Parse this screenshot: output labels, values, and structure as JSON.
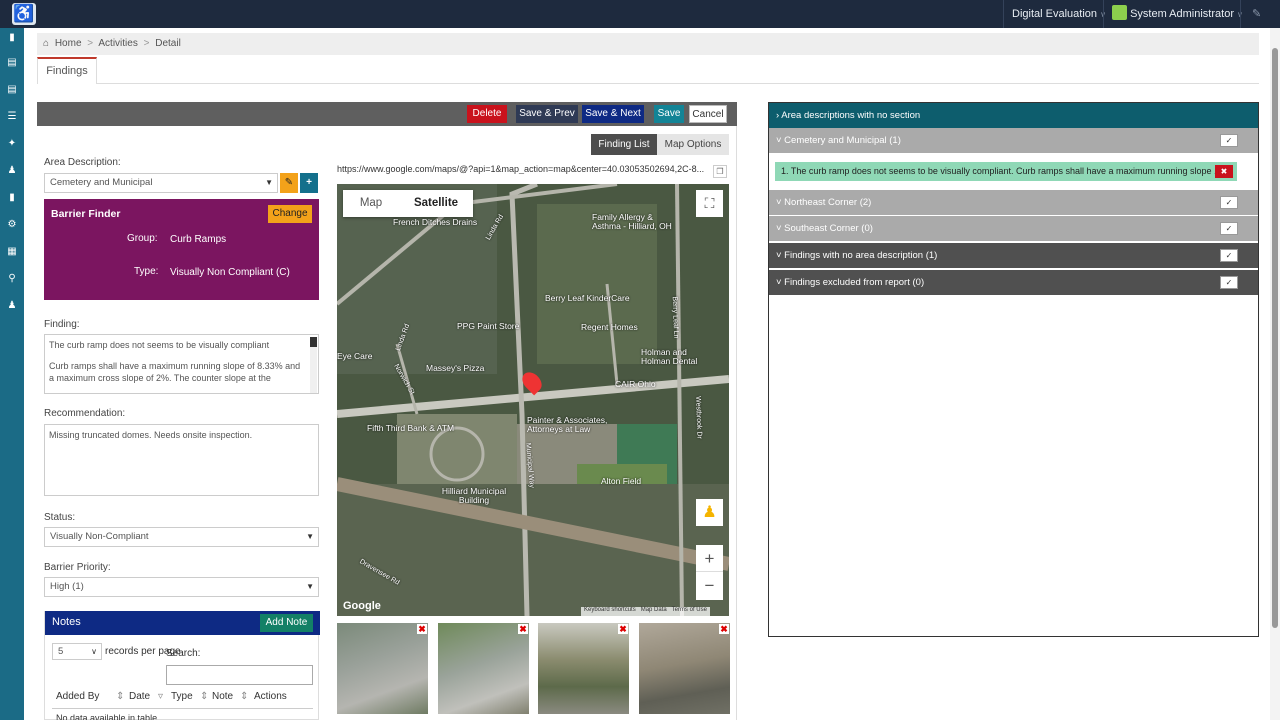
{
  "topbar": {
    "menu_1": "Digital Evaluation",
    "menu_2": "System Administrator"
  },
  "breadcrumb": {
    "home": "Home",
    "activities": "Activities",
    "detail": "Detail",
    "separator": ">"
  },
  "page_tab": "Findings",
  "actions": {
    "delete": "Delete",
    "save_prev": "Save & Prev",
    "save_next": "Save & Next",
    "save": "Save",
    "cancel": "Cancel"
  },
  "view_tabs": {
    "finding_list": "Finding List",
    "map_options": "Map Options"
  },
  "map_url": "https://www.google.com/maps/@?api=1&map_action=map&center=40.03053502694,2C-8...",
  "area_description": {
    "label": "Area Description:",
    "value": "Cemetery and Municipal"
  },
  "barrier_finder": {
    "title": "Barrier Finder",
    "change": "Change",
    "group_label": "Group:",
    "group_value": "Curb Ramps",
    "type_label": "Type:",
    "type_value": "Visually Non Compliant (C)"
  },
  "finding": {
    "label": "Finding:",
    "line1": "The curb ramp does not seems to be visually compliant",
    "line2": "Curb ramps shall have a maximum running slope of 8.33% and a maximum cross slope of 2%. The counter slope at the"
  },
  "recommendation": {
    "label": "Recommendation:",
    "value": "Missing truncated domes. Needs onsite inspection."
  },
  "status": {
    "label": "Status:",
    "value": "Visually Non-Compliant"
  },
  "barrier_priority": {
    "label": "Barrier Priority:",
    "value": "High (1)"
  },
  "notes": {
    "title": "Notes",
    "add_note": "Add Note",
    "per_page_value": "5",
    "per_page_label": "records per page",
    "search_label": "Search:",
    "columns": [
      "Added By",
      "Date",
      "Type",
      "Note",
      "Actions"
    ],
    "empty_text": "No data available in table"
  },
  "map": {
    "type_map": "Map",
    "type_satellite": "Satellite",
    "zoom_in": "+",
    "zoom_out": "−",
    "google": "Google",
    "attribution": "Keyboard shortcuts   Map Data   Terms of Use",
    "places": [
      "French Ditches Drains",
      "Family Allergy & Asthma - Hilliard, OH",
      "Berry Leaf KinderCare",
      "PPG Paint Store",
      "Regent Homes",
      "Holman and Holman Dental",
      "Massey's Pizza",
      "CAIR Ohio",
      "Fifth Third Bank & ATM",
      "Painter & Associates, Attorneys at Law",
      "Alton Field",
      "Hilliard Municipal Building",
      "Eye Care",
      "Linda Rd",
      "Norwich St",
      "Municipal Way",
      "Berry Leaf Ln",
      "Westbrook Dr",
      "Dravensee Rd"
    ]
  },
  "right_panel": {
    "section_no_section": "› Area descriptions with no section",
    "cemetery": "˅  Cemetery and Municipal (1)",
    "finding_item": "1. The curb ramp does not seems to be visually compliant. Curb ramps shall have a maximum running slope ...",
    "northeast": "˅  Northeast Corner (2)",
    "southeast": "˅  Southeast Corner (0)",
    "no_area": "˅  Findings with no area description (1)",
    "excluded": "˅  Findings excluded from report (0)"
  },
  "colors": {
    "topbar": "#1e2a3e",
    "sidebar": "#1b6b86",
    "delete": "#c9121c",
    "save_prev": "#2f3a55",
    "save_next": "#0e2a84",
    "save": "#138496",
    "barrier": "#7b1560",
    "change": "#f3a21a",
    "notes": "#0e2a84",
    "add_note": "#138066",
    "finding_item": "#8fd8b6",
    "section_teal": "#0d5d6d"
  }
}
